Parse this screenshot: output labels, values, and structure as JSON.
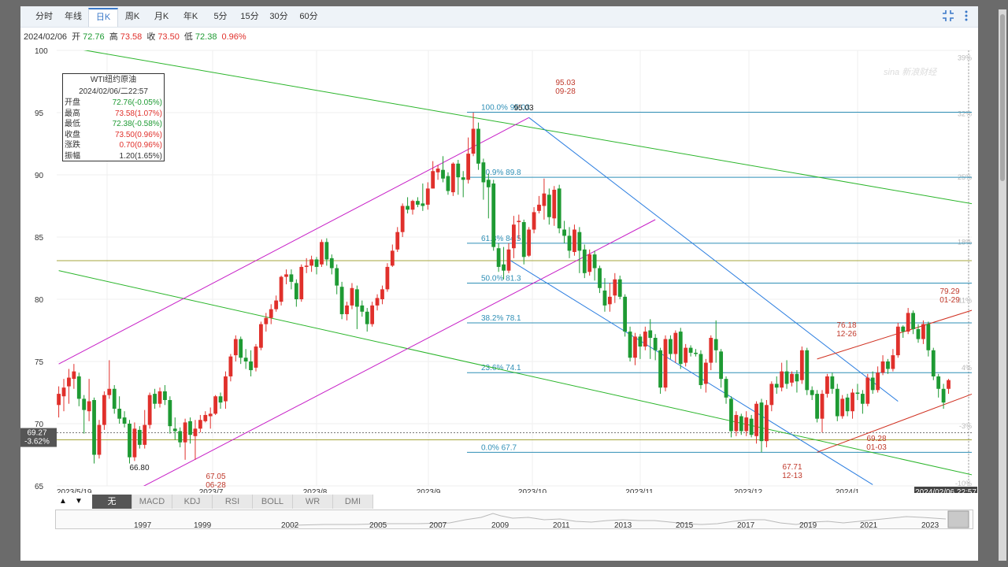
{
  "tabs": [
    {
      "label": "分时"
    },
    {
      "label": "年线"
    },
    {
      "label": "日K"
    },
    {
      "label": "周K"
    },
    {
      "label": "月K"
    },
    {
      "label": "年K"
    },
    {
      "label": "5分"
    },
    {
      "label": "15分"
    },
    {
      "label": "30分"
    },
    {
      "label": "60分"
    }
  ],
  "active_tab": "日K",
  "toolbar": {
    "fullscreen_icon": "fullscreen-icon",
    "menu_icon": "more-vertical-icon"
  },
  "info": {
    "date": "2024/02/06",
    "open_label": "开",
    "open": "72.76",
    "high_label": "高",
    "high": "73.58",
    "close_label": "收",
    "close": "73.50",
    "low_label": "低",
    "low": "72.38",
    "change_pct": "0.96%"
  },
  "infobox": {
    "title": "WTI纽约原油",
    "datetime": "2024/02/06/二22:57",
    "rows": [
      {
        "key": "开盘",
        "value": "72.76(-0.05%)",
        "color": "#1e9a33"
      },
      {
        "key": "最高",
        "value": "73.58(1.07%)",
        "color": "#e0302b"
      },
      {
        "key": "最低",
        "value": "72.38(-0.58%)",
        "color": "#1e9a33"
      },
      {
        "key": "收盘",
        "value": "73.50(0.96%)",
        "color": "#e0302b"
      },
      {
        "key": "涨跌",
        "value": "0.70(0.96%)",
        "color": "#e0302b"
      },
      {
        "key": "振幅",
        "value": "1.20(1.65%)",
        "color": "#333333"
      }
    ]
  },
  "indicators": {
    "tabs": [
      "无",
      "MACD",
      "KDJ",
      "RSI",
      "BOLL",
      "WR",
      "DMI"
    ],
    "active": "无",
    "up_arrow": "▲",
    "down_arrow": "▼"
  },
  "overview": {
    "years": [
      "1997",
      "1999",
      "2002",
      "2005",
      "2007",
      "2009",
      "2011",
      "2013",
      "2015",
      "2017",
      "2019",
      "2021",
      "2023"
    ]
  },
  "chart_data": {
    "type": "candlestick",
    "instrument": "WTI纽约原油",
    "ylim": [
      65,
      100
    ],
    "y_ticks": [
      65,
      70,
      75,
      80,
      85,
      90,
      95,
      100
    ],
    "x_tick_labels": [
      {
        "label": "2023/5/19",
        "index": 0
      },
      {
        "label": "2023/7",
        "index": 29
      },
      {
        "label": "2023/8",
        "index": 50
      },
      {
        "label": "2023/9",
        "index": 73
      },
      {
        "label": "2023/10",
        "index": 93
      },
      {
        "label": "2023/11",
        "index": 115
      },
      {
        "label": "2023/12",
        "index": 137
      },
      {
        "label": "2024/1",
        "index": 158
      },
      {
        "label": "2024/02/06 22:57",
        "index": 181
      }
    ],
    "right_axis_pct": [
      "39%",
      "32%",
      "25%",
      "18%",
      "11%",
      "4%",
      "-3%",
      "-10%"
    ],
    "right_axis_pct_values": [
      99.4,
      94.9,
      89.8,
      84.6,
      79.9,
      74.5,
      69.8,
      65.2
    ],
    "crosshair": {
      "price_label": "69.27",
      "pct_label": "-3.62%",
      "value": 69.27
    },
    "fibonacci": [
      {
        "label": "100.0% 95.03",
        "value": 95.03
      },
      {
        "label": "80.9% 89.8",
        "value": 89.8
      },
      {
        "label": "61.8% 84.5",
        "value": 84.5
      },
      {
        "label": "50.0% 81.3",
        "value": 81.3
      },
      {
        "label": "38.2% 78.1",
        "value": 78.1
      },
      {
        "label": "23.6% 74.1",
        "value": 74.1
      },
      {
        "label": "0.0% 67.7",
        "value": 67.7
      }
    ],
    "annotations": [
      {
        "text": "95.03",
        "sub": "09-28",
        "value": 95.03,
        "color": "#c0392b"
      },
      {
        "text": "95.03",
        "value": 95.03,
        "color": "#222222"
      },
      {
        "text": "66.80",
        "value": 66.8,
        "color": "#222222"
      },
      {
        "text": "67.05",
        "sub": "06-28",
        "value": 67.05,
        "color": "#c0392b"
      },
      {
        "text": "67.71",
        "sub": "12-13",
        "value": 67.71,
        "color": "#c0392b"
      },
      {
        "text": "69.28",
        "sub": "01-03",
        "value": 69.28,
        "color": "#c0392b"
      },
      {
        "text": "76.18",
        "sub": "12-26",
        "value": 76.18,
        "color": "#c0392b"
      },
      {
        "text": "79.29",
        "sub": "01-29",
        "value": 79.29,
        "color": "#c0392b"
      }
    ],
    "olive_lines": [
      83.1,
      69.27,
      68.7
    ],
    "trendlines": [
      {
        "color": "#2ab52a",
        "from": [
          -16,
          101.5
        ],
        "to": [
          186,
          87.3
        ]
      },
      {
        "color": "#2ab52a",
        "from": [
          0,
          82.3
        ],
        "to": [
          186,
          65.4
        ]
      },
      {
        "color": "#c71fc7",
        "from": [
          0,
          74.8
        ],
        "to": [
          93,
          94.6
        ]
      },
      {
        "color": "#c71fc7",
        "from": [
          15,
          64.6
        ],
        "to": [
          118,
          86.4
        ]
      },
      {
        "color": "#2a7de0",
        "from": [
          93,
          94.6
        ],
        "to": [
          166,
          71.8
        ]
      },
      {
        "color": "#2a7de0",
        "from": [
          89,
          83.2
        ],
        "to": [
          161,
          65.1
        ]
      },
      {
        "color": "#d03020",
        "from": [
          150,
          75.2
        ],
        "to": [
          186,
          79.8
        ]
      },
      {
        "color": "#d03020",
        "from": [
          150,
          67.7
        ],
        "to": [
          186,
          73.2
        ]
      }
    ],
    "candles": [
      [
        71.5,
        72.4,
        73.0,
        70.5
      ],
      [
        72.2,
        72.9,
        73.6,
        71.0
      ],
      [
        73.0,
        73.7,
        74.4,
        71.6
      ],
      [
        73.6,
        74.2,
        74.8,
        72.8
      ],
      [
        73.8,
        72.0,
        74.1,
        71.4
      ],
      [
        72.0,
        71.1,
        72.3,
        69.2
      ],
      [
        71.0,
        71.8,
        73.6,
        70.2
      ],
      [
        71.9,
        67.5,
        72.1,
        66.8
      ],
      [
        67.5,
        69.9,
        70.3,
        67.2
      ],
      [
        69.9,
        72.3,
        72.6,
        69.5
      ],
      [
        72.3,
        72.8,
        75.1,
        72.0
      ],
      [
        72.8,
        71.2,
        73.1,
        70.8
      ],
      [
        71.2,
        70.4,
        72.2,
        70.0
      ],
      [
        70.5,
        70.0,
        71.0,
        69.7
      ],
      [
        70.0,
        67.3,
        70.3,
        66.8
      ],
      [
        67.3,
        69.6,
        70.1,
        67.0
      ],
      [
        69.5,
        68.3,
        69.8,
        68.0
      ],
      [
        68.3,
        69.9,
        71.1,
        68.0
      ],
      [
        69.9,
        72.3,
        72.5,
        69.6
      ],
      [
        72.4,
        71.6,
        72.8,
        71.2
      ],
      [
        71.6,
        72.6,
        72.9,
        71.3
      ],
      [
        72.6,
        71.9,
        73.1,
        71.5
      ],
      [
        71.9,
        69.8,
        72.2,
        69.2
      ],
      [
        69.6,
        69.4,
        70.5,
        68.7
      ],
      [
        69.4,
        68.5,
        69.7,
        68.1
      ],
      [
        68.5,
        70.1,
        70.4,
        67.1
      ],
      [
        70.2,
        69.1,
        70.5,
        68.4
      ],
      [
        69.0,
        69.6,
        70.3,
        67.1
      ],
      [
        69.6,
        70.3,
        70.7,
        69.3
      ],
      [
        70.2,
        70.7,
        71.0,
        70.1
      ],
      [
        70.6,
        70.8,
        71.3,
        69.6
      ],
      [
        70.8,
        72.2,
        72.3,
        70.7
      ],
      [
        72.2,
        71.7,
        72.5,
        71.2
      ],
      [
        71.8,
        73.8,
        74.2,
        71.2
      ],
      [
        73.8,
        75.4,
        75.6,
        73.4
      ],
      [
        75.5,
        76.8,
        77.1,
        75.0
      ],
      [
        76.8,
        75.3,
        77.0,
        74.8
      ],
      [
        75.3,
        75.0,
        76.0,
        74.4
      ],
      [
        75.0,
        74.3,
        75.9,
        73.8
      ],
      [
        74.5,
        76.2,
        76.4,
        74.2
      ],
      [
        76.1,
        78.0,
        78.2,
        75.9
      ],
      [
        78.0,
        78.5,
        78.9,
        77.4
      ],
      [
        78.5,
        79.2,
        79.6,
        78.0
      ],
      [
        79.2,
        79.9,
        80.3,
        79.0
      ],
      [
        79.8,
        81.8,
        81.9,
        79.5
      ],
      [
        81.8,
        82.0,
        82.4,
        81.2
      ],
      [
        82.0,
        81.4,
        82.4,
        80.8
      ],
      [
        81.3,
        80.0,
        81.6,
        79.4
      ],
      [
        80.0,
        82.6,
        82.8,
        79.8
      ],
      [
        82.6,
        82.7,
        83.3,
        82.1
      ],
      [
        82.7,
        83.2,
        83.5,
        82.2
      ],
      [
        83.2,
        82.6,
        83.4,
        82.0
      ],
      [
        82.8,
        84.6,
        84.8,
        82.6
      ],
      [
        84.6,
        83.2,
        84.9,
        82.7
      ],
      [
        83.3,
        82.5,
        83.6,
        82.0
      ],
      [
        82.5,
        81.1,
        82.8,
        80.4
      ],
      [
        81.0,
        78.8,
        81.4,
        78.4
      ],
      [
        78.8,
        79.5,
        79.8,
        78.3
      ],
      [
        79.5,
        80.9,
        81.3,
        79.2
      ],
      [
        80.8,
        79.4,
        81.1,
        77.6
      ],
      [
        79.5,
        79.0,
        79.9,
        78.6
      ],
      [
        79.0,
        78.0,
        79.3,
        77.4
      ],
      [
        78.0,
        79.5,
        79.8,
        77.8
      ],
      [
        79.5,
        80.1,
        80.4,
        79.1
      ],
      [
        80.0,
        80.8,
        81.1,
        79.6
      ],
      [
        80.8,
        82.6,
        82.9,
        80.6
      ],
      [
        82.7,
        83.9,
        84.4,
        82.6
      ],
      [
        84.0,
        85.4,
        85.8,
        83.8
      ],
      [
        85.4,
        87.5,
        87.7,
        85.0
      ],
      [
        87.5,
        87.2,
        88.2,
        86.9
      ],
      [
        87.2,
        87.9,
        88.0,
        86.8
      ],
      [
        87.9,
        87.6,
        88.2,
        87.4
      ],
      [
        87.7,
        87.5,
        89.3,
        87.1
      ],
      [
        87.6,
        88.9,
        89.4,
        87.2
      ],
      [
        88.9,
        90.3,
        91.1,
        88.9
      ],
      [
        90.2,
        90.5,
        90.8,
        89.6
      ],
      [
        90.4,
        89.7,
        91.5,
        89.4
      ],
      [
        89.9,
        88.7,
        90.2,
        88.4
      ],
      [
        88.6,
        90.9,
        91.0,
        88.3
      ],
      [
        90.9,
        89.8,
        91.2,
        88.4
      ],
      [
        89.8,
        89.6,
        90.3,
        88.2
      ],
      [
        89.6,
        91.7,
        93.0,
        89.3
      ],
      [
        91.7,
        93.7,
        95.0,
        91.5
      ],
      [
        93.7,
        90.9,
        94.2,
        90.4
      ],
      [
        91.0,
        89.4,
        91.3,
        88.0
      ],
      [
        89.6,
        89.0,
        90.1,
        86.5
      ],
      [
        89.3,
        84.2,
        89.6,
        83.9
      ],
      [
        84.1,
        82.6,
        84.5,
        82.2
      ],
      [
        82.8,
        82.3,
        84.2,
        81.6
      ],
      [
        82.3,
        84.0,
        84.5,
        82.1
      ],
      [
        84.1,
        86.0,
        86.7,
        83.3
      ],
      [
        86.2,
        86.3,
        86.8,
        84.8
      ],
      [
        86.2,
        83.4,
        86.4,
        82.8
      ],
      [
        83.5,
        85.6,
        85.8,
        83.4
      ],
      [
        85.6,
        87.0,
        87.4,
        85.3
      ],
      [
        87.1,
        87.6,
        88.3,
        86.9
      ],
      [
        87.5,
        88.5,
        89.7,
        86.4
      ],
      [
        88.4,
        86.6,
        88.9,
        86.0
      ],
      [
        86.5,
        88.8,
        89.1,
        85.9
      ],
      [
        88.9,
        85.7,
        89.2,
        85.3
      ],
      [
        85.6,
        85.1,
        86.3,
        84.5
      ],
      [
        85.1,
        83.9,
        85.8,
        83.3
      ],
      [
        83.8,
        85.6,
        86.0,
        83.5
      ],
      [
        85.4,
        83.9,
        85.8,
        82.1
      ],
      [
        84.0,
        82.1,
        84.4,
        81.7
      ],
      [
        82.2,
        83.6,
        84.0,
        81.9
      ],
      [
        83.6,
        82.5,
        83.9,
        81.5
      ],
      [
        82.5,
        80.9,
        82.7,
        80.5
      ],
      [
        80.7,
        79.5,
        81.7,
        79.0
      ],
      [
        79.6,
        80.2,
        81.3,
        79.0
      ],
      [
        80.3,
        81.6,
        82.1,
        79.7
      ],
      [
        81.6,
        80.2,
        81.9,
        80.0
      ],
      [
        80.2,
        77.4,
        80.4,
        77.0
      ],
      [
        77.4,
        75.3,
        77.8,
        75.0
      ],
      [
        75.3,
        77.0,
        77.3,
        74.7
      ],
      [
        77.0,
        76.2,
        77.2,
        75.2
      ],
      [
        76.2,
        77.4,
        77.8,
        75.9
      ],
      [
        77.5,
        76.9,
        78.4,
        75.2
      ],
      [
        76.9,
        75.9,
        77.2,
        75.1
      ],
      [
        75.9,
        72.9,
        76.1,
        72.4
      ],
      [
        72.9,
        76.8,
        77.1,
        72.6
      ],
      [
        76.8,
        75.6,
        77.1,
        75.2
      ],
      [
        75.6,
        77.3,
        77.5,
        74.9
      ],
      [
        77.4,
        74.8,
        77.7,
        74.4
      ],
      [
        74.9,
        76.1,
        76.4,
        74.6
      ],
      [
        76.1,
        75.7,
        76.3,
        75.4
      ],
      [
        75.7,
        75.6,
        76.0,
        75.4
      ],
      [
        75.6,
        73.1,
        75.9,
        72.8
      ],
      [
        73.2,
        74.9,
        75.2,
        72.5
      ],
      [
        74.9,
        76.9,
        77.1,
        74.3
      ],
      [
        76.8,
        75.9,
        78.3,
        74.9
      ],
      [
        75.8,
        73.6,
        76.0,
        72.9
      ],
      [
        73.6,
        72.1,
        73.8,
        71.6
      ],
      [
        72.0,
        69.4,
        72.2,
        68.9
      ],
      [
        69.4,
        70.7,
        71.0,
        69.0
      ],
      [
        70.6,
        69.4,
        70.8,
        69.1
      ],
      [
        69.4,
        70.5,
        71.0,
        69.0
      ],
      [
        70.4,
        69.1,
        70.7,
        68.9
      ],
      [
        69.0,
        71.6,
        71.8,
        68.4
      ],
      [
        71.7,
        68.6,
        72.0,
        67.7
      ],
      [
        68.6,
        71.5,
        71.9,
        68.1
      ],
      [
        71.5,
        73.2,
        73.4,
        71.0
      ],
      [
        73.2,
        72.9,
        73.8,
        72.4
      ],
      [
        72.9,
        74.2,
        74.9,
        72.6
      ],
      [
        74.2,
        73.2,
        75.1,
        72.8
      ],
      [
        73.3,
        74.0,
        74.2,
        73.0
      ],
      [
        74.0,
        73.4,
        74.3,
        72.5
      ],
      [
        73.5,
        75.9,
        76.2,
        73.2
      ],
      [
        75.9,
        72.7,
        76.1,
        72.3
      ],
      [
        72.7,
        72.3,
        73.0,
        71.9
      ],
      [
        72.4,
        70.4,
        72.7,
        70.1
      ],
      [
        70.4,
        72.4,
        72.7,
        69.3
      ],
      [
        72.4,
        73.8,
        74.0,
        72.1
      ],
      [
        73.8,
        72.8,
        74.1,
        72.4
      ],
      [
        72.8,
        70.6,
        73.2,
        70.2
      ],
      [
        70.6,
        72.0,
        72.3,
        70.4
      ],
      [
        72.1,
        71.0,
        72.4,
        70.6
      ],
      [
        71.0,
        72.5,
        72.8,
        70.4
      ],
      [
        72.5,
        72.4,
        73.2,
        71.9
      ],
      [
        72.4,
        71.6,
        72.7,
        70.8
      ],
      [
        71.6,
        73.7,
        74.0,
        71.4
      ],
      [
        73.7,
        72.7,
        74.2,
        72.4
      ],
      [
        72.7,
        74.1,
        74.6,
        72.5
      ],
      [
        74.1,
        75.0,
        75.5,
        73.9
      ],
      [
        75.0,
        74.4,
        75.2,
        74.0
      ],
      [
        74.4,
        75.5,
        76.0,
        74.2
      ],
      [
        75.5,
        77.8,
        78.1,
        75.3
      ],
      [
        77.8,
        77.4,
        77.9,
        76.9
      ],
      [
        77.4,
        78.9,
        79.3,
        77.2
      ],
      [
        78.9,
        77.6,
        79.1,
        77.2
      ],
      [
        77.6,
        76.8,
        78.0,
        76.5
      ],
      [
        76.8,
        78.0,
        78.3,
        76.4
      ],
      [
        78.0,
        75.9,
        78.2,
        75.4
      ],
      [
        75.9,
        73.8,
        76.1,
        73.5
      ],
      [
        73.8,
        72.8,
        74.0,
        72.1
      ],
      [
        72.8,
        71.7,
        73.2,
        71.2
      ],
      [
        72.8,
        73.5,
        73.6,
        72.4
      ]
    ]
  }
}
